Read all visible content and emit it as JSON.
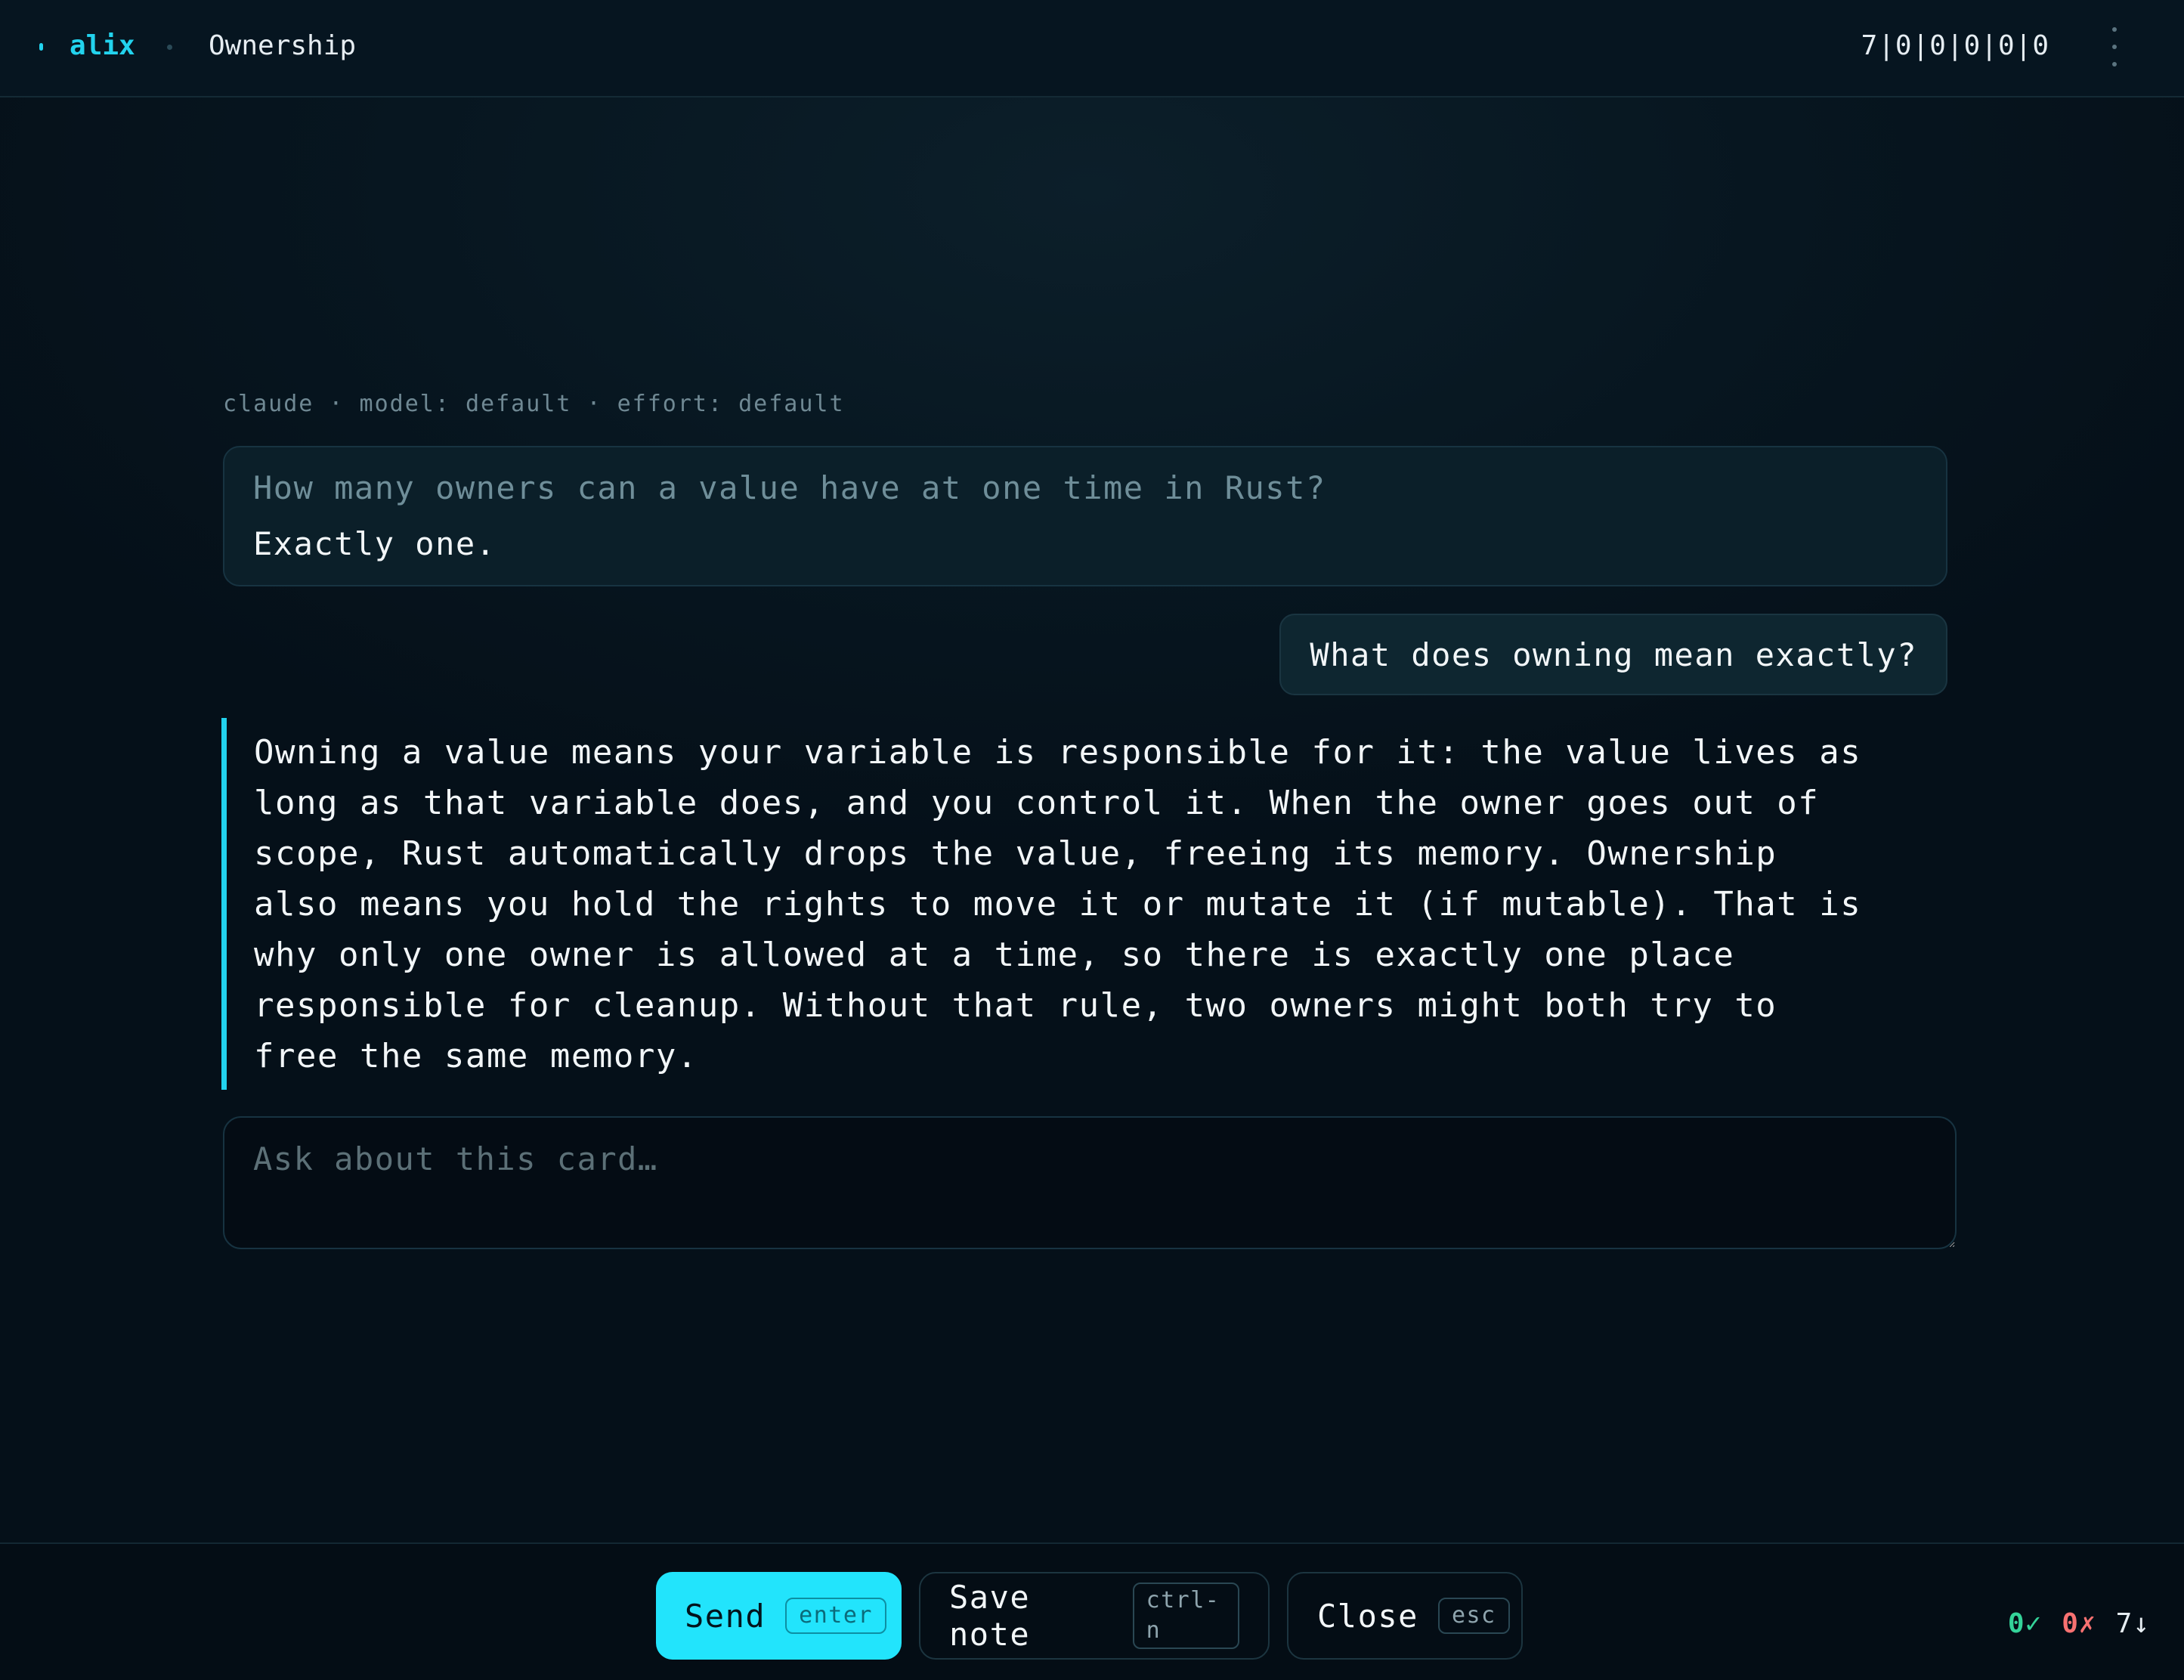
{
  "header": {
    "brand": "alix",
    "deck_title": "Ownership",
    "counts": "7|0|0|0|0|0"
  },
  "session": {
    "meta": "claude · model: default · effort: default"
  },
  "card": {
    "question": "How many owners can a value have at one time in Rust?",
    "answer": "Exactly one."
  },
  "chat": {
    "user_message": "What does owning mean exactly?",
    "assistant_lines": [
      "Owning a value means your variable is responsible for it: the value lives as",
      "long as that variable does, and you control it. When the owner goes out of",
      "scope, Rust automatically drops the value, freeing its memory. Ownership",
      "also means you hold the rights to move it or mutate it (if mutable). That is",
      "why only one owner is allowed at a time, so there is exactly one place",
      "responsible for cleanup. Without that rule, two owners might both try to",
      "free the same memory."
    ]
  },
  "input": {
    "placeholder": "Ask about this card…",
    "value": ""
  },
  "footer": {
    "send_label": "Send",
    "send_key": "enter",
    "note_label": "Save note",
    "note_key": "ctrl-n",
    "close_label": "Close",
    "close_key": "esc",
    "stats": {
      "correct": "0✓",
      "wrong": "0✗",
      "due": "7↓"
    }
  },
  "colors": {
    "accent": "#22d3ee",
    "background": "#051019",
    "success": "#34d399",
    "error": "#f87171"
  },
  "icons": {
    "menu": "more-vertical-icon"
  }
}
